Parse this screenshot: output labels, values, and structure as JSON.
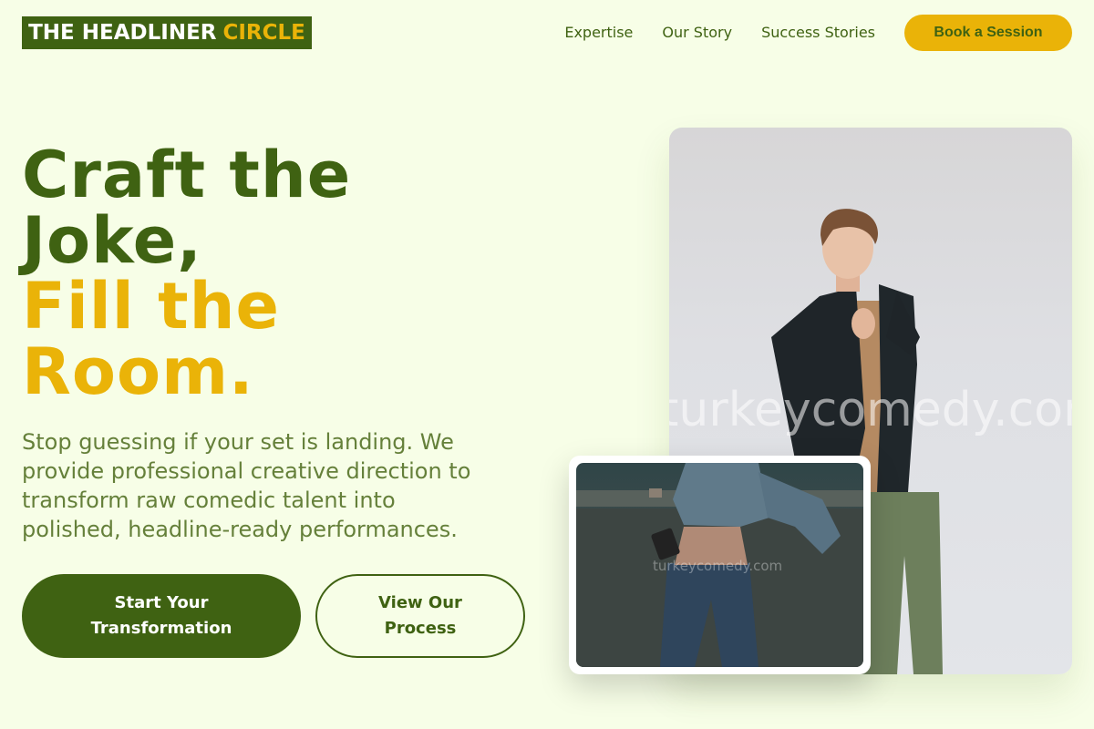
{
  "brand": {
    "name_main": "THE HEADLINER",
    "name_accent": "CIRCLE"
  },
  "nav": {
    "links": [
      "Expertise",
      "Our Story",
      "Success Stories"
    ],
    "cta_label": "Book a Session"
  },
  "hero": {
    "title_line1": "Craft the",
    "title_line2": "Joke,",
    "title_line3": "Fill the",
    "title_line4": "Room.",
    "description": "Stop guessing if your set is landing. We provide professional creative direction to transform raw comedic talent into polished, headline-ready performances.",
    "primary_button": "Start Your Transformation",
    "secondary_button": "View Our Process"
  },
  "images": {
    "main_watermark": "turkeycomedy.com",
    "inset_watermark": "turkeycomedy.com"
  },
  "colors": {
    "background": "#f7fee7",
    "primary_green": "#3f6212",
    "accent_gold": "#eab308",
    "body_text": "#65803a"
  }
}
